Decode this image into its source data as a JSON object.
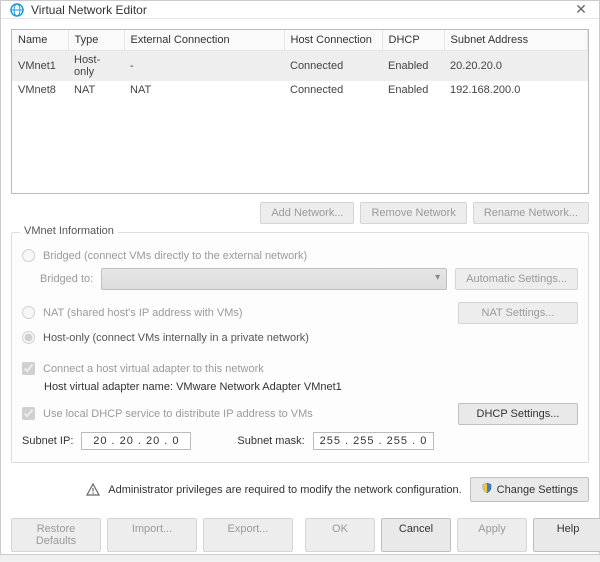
{
  "titlebar": {
    "title": "Virtual Network Editor"
  },
  "table": {
    "headers": {
      "name": "Name",
      "type": "Type",
      "external": "External Connection",
      "hostconn": "Host Connection",
      "dhcp": "DHCP",
      "subnet": "Subnet Address"
    },
    "rows": [
      {
        "name": "VMnet1",
        "type": "Host-only",
        "external": "-",
        "hostconn": "Connected",
        "dhcp": "Enabled",
        "subnet": "20.20.20.0"
      },
      {
        "name": "VMnet8",
        "type": "NAT",
        "external": "NAT",
        "hostconn": "Connected",
        "dhcp": "Enabled",
        "subnet": "192.168.200.0"
      }
    ]
  },
  "buttons": {
    "add_network": "Add Network...",
    "remove_network": "Remove Network",
    "rename_network": "Rename Network...",
    "auto_settings": "Automatic Settings...",
    "nat_settings": "NAT Settings...",
    "dhcp_settings": "DHCP Settings...",
    "change_settings": "Change Settings",
    "restore_defaults": "Restore Defaults",
    "import": "Import...",
    "export": "Export...",
    "ok": "OK",
    "cancel": "Cancel",
    "apply": "Apply",
    "help": "Help"
  },
  "group": {
    "title": "VMnet Information",
    "bridged": "Bridged (connect VMs directly to the external network)",
    "bridged_to": "Bridged to:",
    "nat": "NAT (shared host's IP address with VMs)",
    "hostonly": "Host-only (connect VMs internally in a private network)",
    "connect_host_adapter": "Connect a host virtual adapter to this network",
    "host_adapter_name_prefix": "Host virtual adapter name: ",
    "host_adapter_name_value": "VMware Network Adapter VMnet1",
    "use_dhcp": "Use local DHCP service to distribute IP address to VMs",
    "subnet_ip_label": "Subnet IP:",
    "subnet_ip_value": "20 . 20 . 20 . 0",
    "subnet_mask_label": "Subnet mask:",
    "subnet_mask_value": "255 . 255 . 255 . 0"
  },
  "privileges": {
    "text": "Administrator privileges are required to modify the network configuration."
  }
}
